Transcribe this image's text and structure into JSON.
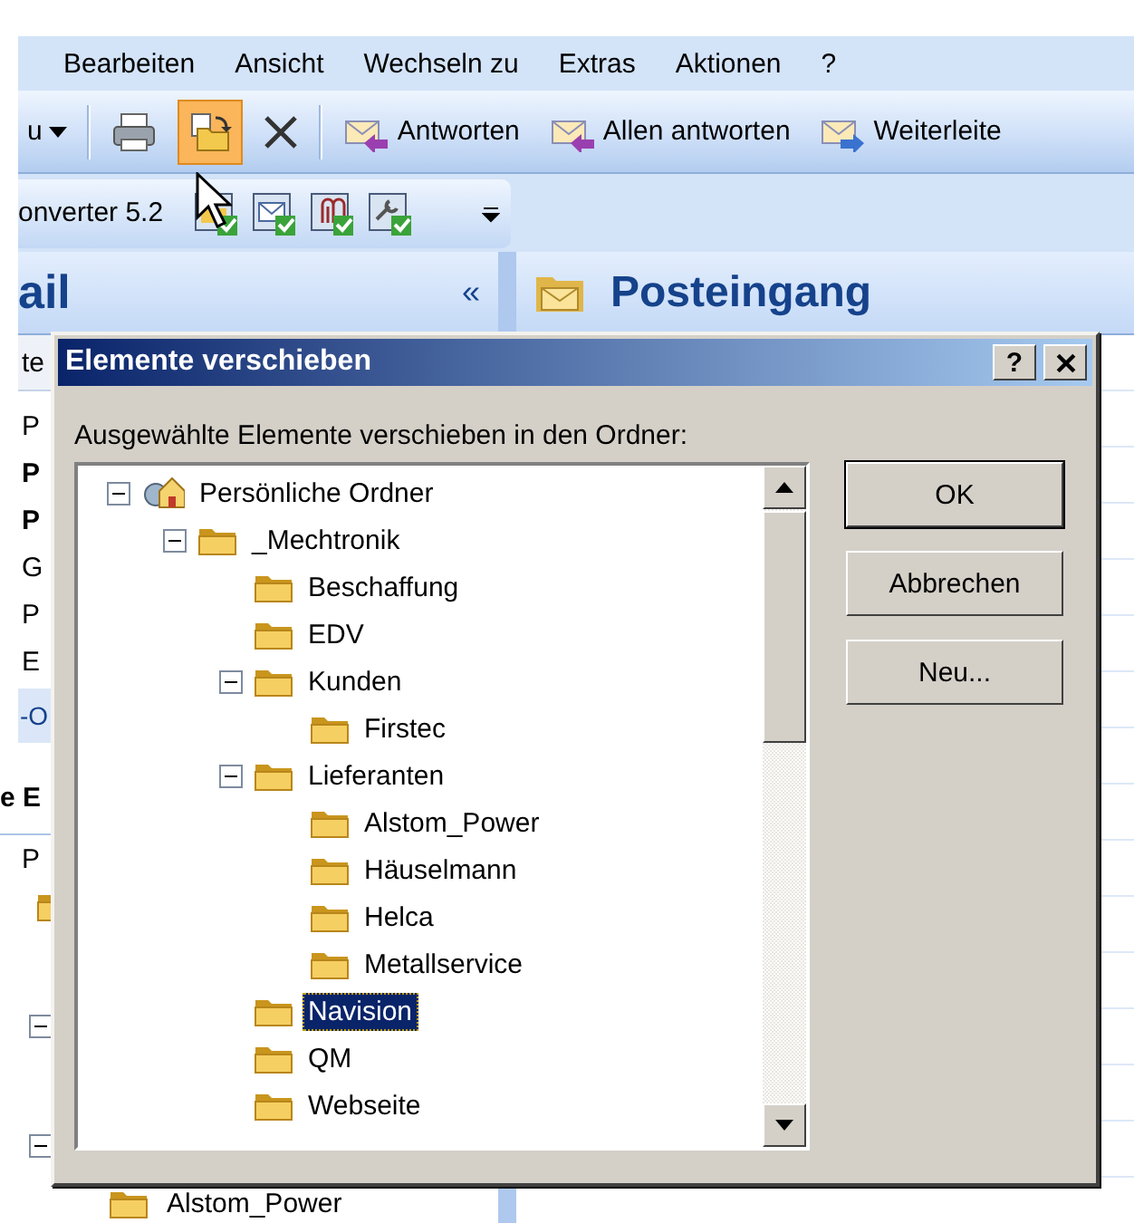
{
  "menu": [
    {
      "label": "Bearbeiten"
    },
    {
      "label": "Ansicht"
    },
    {
      "label": "Wechseln zu"
    },
    {
      "label": "Extras"
    },
    {
      "label": "Aktionen"
    },
    {
      "label": "?"
    }
  ],
  "toolbar": [
    {
      "kind": "dropdown",
      "label": "u",
      "highlighted": false
    },
    {
      "kind": "separator"
    },
    {
      "kind": "print",
      "highlighted": false
    },
    {
      "kind": "move",
      "highlighted": true
    },
    {
      "kind": "delete",
      "highlighted": false
    },
    {
      "kind": "separator"
    },
    {
      "kind": "reply",
      "label": "Antworten",
      "highlighted": false
    },
    {
      "kind": "reply-all",
      "label": "Allen antworten",
      "highlighted": false
    },
    {
      "kind": "forward",
      "label": "Weiterleite",
      "highlighted": false
    }
  ],
  "toolbar2": {
    "label": "onverter 5.2",
    "buttons": [
      {
        "kind": "folder"
      },
      {
        "kind": "mail"
      },
      {
        "kind": "clip"
      },
      {
        "kind": "tool"
      }
    ]
  },
  "nav_pane": {
    "title": "ail",
    "collapse_label": "«",
    "rows": [
      {
        "kind": "column-header",
        "text": "te"
      },
      {
        "kind": "item",
        "text": "P",
        "bold": false
      },
      {
        "kind": "item",
        "text": "P",
        "bold": true
      },
      {
        "kind": "item",
        "text": "P",
        "bold": true
      },
      {
        "kind": "item",
        "text": "G",
        "bold": false
      },
      {
        "kind": "item",
        "text": "P",
        "bold": false
      },
      {
        "kind": "item",
        "text": "E",
        "bold": false
      },
      {
        "kind": "bar",
        "text": "-O"
      },
      {
        "kind": "group",
        "text": "e E"
      },
      {
        "kind": "item",
        "text": "P",
        "bold": false
      },
      {
        "kind": "folder"
      },
      {
        "kind": "toggle",
        "expanded": true
      },
      {
        "kind": "toggle",
        "expanded": true
      },
      {
        "kind": "folder",
        "text": "Alstom_Power"
      }
    ]
  },
  "content": {
    "title": "Posteingang"
  },
  "dialog": {
    "title": "Elemente verschieben",
    "help_label": "?",
    "prompt": "Ausgewählte Elemente verschieben in den Ordner:",
    "tree": [
      {
        "label": "Persönliche Ordner",
        "kind": "store",
        "expanded": true,
        "selected": false,
        "children": [
          {
            "label": "_Mechtronik",
            "kind": "folder",
            "expanded": true,
            "selected": false,
            "children": [
              {
                "label": "Beschaffung",
                "kind": "folder",
                "selected": false
              },
              {
                "label": "EDV",
                "kind": "folder",
                "selected": false
              },
              {
                "label": "Kunden",
                "kind": "folder",
                "expanded": true,
                "selected": false,
                "children": [
                  {
                    "label": "Firstec",
                    "kind": "folder",
                    "selected": false
                  }
                ]
              },
              {
                "label": "Lieferanten",
                "kind": "folder",
                "expanded": true,
                "selected": false,
                "children": [
                  {
                    "label": "Alstom_Power",
                    "kind": "folder",
                    "selected": false
                  },
                  {
                    "label": "Häuselmann",
                    "kind": "folder",
                    "selected": false
                  },
                  {
                    "label": "Helca",
                    "kind": "folder",
                    "selected": false
                  },
                  {
                    "label": "Metallservice",
                    "kind": "folder",
                    "selected": false
                  }
                ]
              },
              {
                "label": "Navision",
                "kind": "folder",
                "selected": true
              },
              {
                "label": "QM",
                "kind": "folder",
                "selected": false
              },
              {
                "label": "Webseite",
                "kind": "folder",
                "selected": false
              }
            ]
          }
        ]
      }
    ],
    "buttons": [
      {
        "label": "OK",
        "default": true
      },
      {
        "label": "Abbrechen",
        "default": false
      },
      {
        "label": "Neu...",
        "default": false
      }
    ]
  }
}
